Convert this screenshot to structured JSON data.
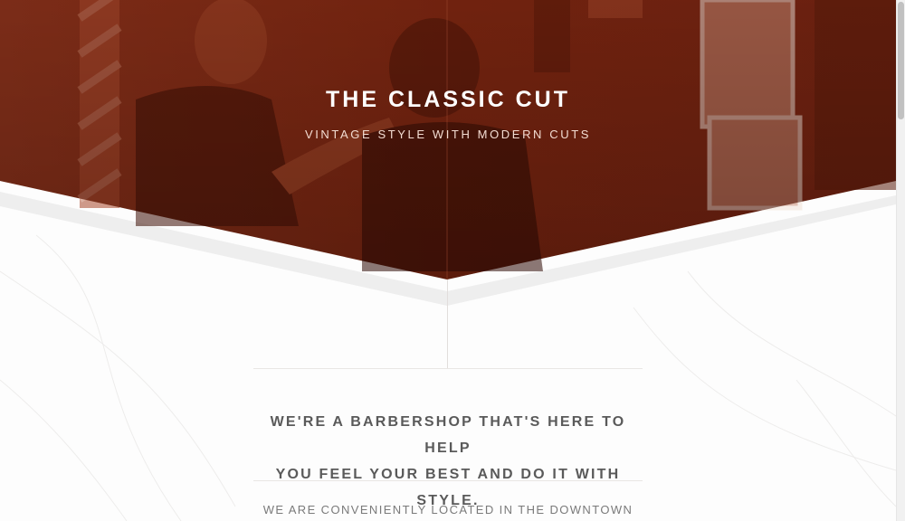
{
  "hero": {
    "title": "THE CLASSIC CUT",
    "subtitle": "VINTAGE STYLE WITH MODERN CUTS",
    "overlay_color": "#7a2510"
  },
  "intro": {
    "tagline_line1": "WE'RE A BARBERSHOP THAT'S HERE TO HELP",
    "tagline_line2": "YOU FEEL YOUR BEST AND DO IT WITH STYLE.",
    "location_text": "WE ARE CONVENIENTLY LOCATED IN THE DOWNTOWN"
  }
}
